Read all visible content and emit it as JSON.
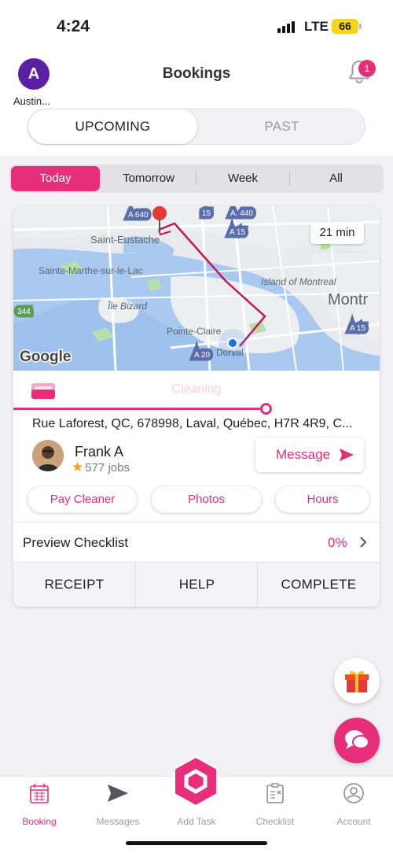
{
  "status_bar": {
    "time": "4:24",
    "network": "LTE",
    "battery": "66"
  },
  "header": {
    "avatar_initial": "A",
    "avatar_name": "Austin...",
    "title": "Bookings",
    "notification_count": "1",
    "segments": [
      "UPCOMING",
      "PAST"
    ],
    "selected_segment": "UPCOMING"
  },
  "day_filter": {
    "options": [
      "Today",
      "Tomorrow",
      "Week",
      "All"
    ],
    "selected": "Today"
  },
  "booking": {
    "map": {
      "eta": "21 min",
      "places": [
        "Saint-Eustache",
        "Sainte-Marthe-sur-le-Lac",
        "Île Bizard",
        "Pointe-Claire",
        "Dorval",
        "Island of Montreal",
        "Montr"
      ],
      "roads": [
        "A 640",
        "15",
        "A. 440",
        "A 15",
        "344",
        "A 20",
        "A 15"
      ],
      "attribution": "Google"
    },
    "status": "Cleaning",
    "progress": 0.69,
    "address": "Rue Laforest, QC, 678998, Laval, Québec, H7R 4R9, C...",
    "cleaner": {
      "name": "Frank A",
      "jobs": "577 jobs"
    },
    "message_label": "Message",
    "pills": [
      "Pay Cleaner",
      "Photos",
      "Hours"
    ],
    "checklist": {
      "label": "Preview Checklist",
      "percent": "0%"
    },
    "actions": [
      "RECEIPT",
      "HELP",
      "COMPLETE"
    ]
  },
  "tabbar": {
    "tabs": [
      {
        "label": "Booking",
        "icon": "calendar-icon"
      },
      {
        "label": "Messages",
        "icon": "send-icon"
      },
      {
        "label": "Add Task",
        "icon": "hexagon-plus-icon"
      },
      {
        "label": "Checklist",
        "icon": "clipboard-icon"
      },
      {
        "label": "Account",
        "icon": "user-icon"
      }
    ],
    "active": "Booking"
  },
  "colors": {
    "accent": "#e62e7a",
    "avatar": "#5b1fa3",
    "battery": "#f7d51d"
  }
}
